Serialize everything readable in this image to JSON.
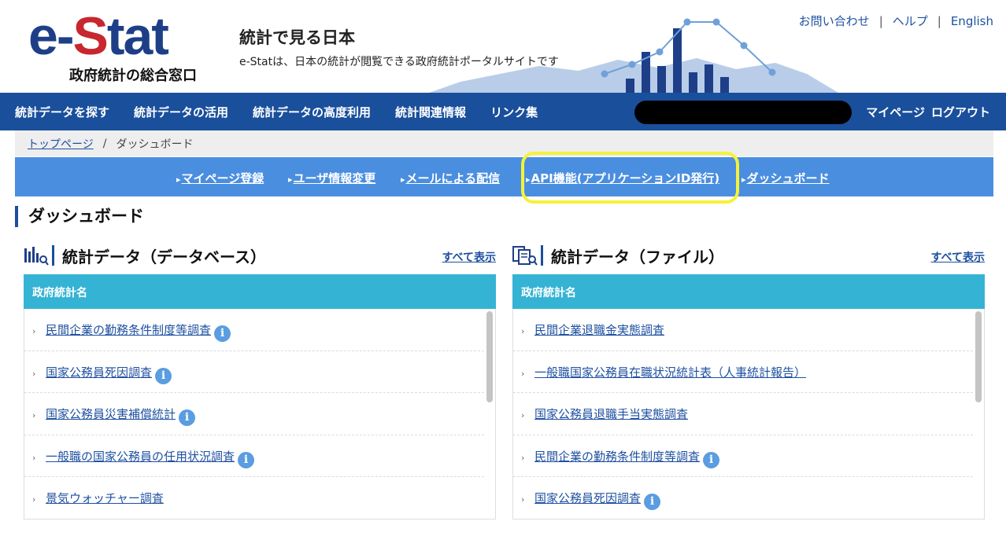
{
  "header": {
    "logo": "e-Stat",
    "logo_sub": "政府統計の総合窓口",
    "title": "統計で見る日本",
    "description": "e-Statは、日本の統計が閲覧できる政府統計ポータルサイトです",
    "links": [
      "お問い合わせ",
      "ヘルプ",
      "English"
    ]
  },
  "mainnav": {
    "items": [
      "統計データを探す",
      "統計データの活用",
      "統計データの高度利用",
      "統計関連情報",
      "リンク集"
    ],
    "mypage": "マイページ",
    "logout": "ログアウト"
  },
  "breadcrumb": {
    "home": "トップページ",
    "sep": "/",
    "current": "ダッシュボード"
  },
  "subnav": {
    "items": [
      "マイページ登録",
      "ユーザ情報変更",
      "メールによる配信",
      "API機能(アプリケーションID発行)",
      "ダッシュボード"
    ]
  },
  "page_title": "ダッシュボード",
  "panels": [
    {
      "title": "統計データ（データベース）",
      "show_all": "すべて表示",
      "column": "政府統計名",
      "rows": [
        "民間企業の勤務条件制度等調査",
        "国家公務員死因調査",
        "国家公務員災害補償統計",
        "一般職の国家公務員の任用状況調査",
        "景気ウォッチャー調査"
      ],
      "info": [
        true,
        true,
        true,
        true,
        false
      ]
    },
    {
      "title": "統計データ（ファイル）",
      "show_all": "すべて表示",
      "column": "政府統計名",
      "rows": [
        "民間企業退職金実態調査",
        "一般職国家公務員在職状況統計表（人事統計報告）",
        "国家公務員退職手当実態調査",
        "民間企業の勤務条件制度等調査",
        "国家公務員死因調査"
      ],
      "info": [
        false,
        false,
        false,
        true,
        true
      ]
    }
  ],
  "info_glyph": "i",
  "colors": {
    "nav": "#1a4f9c",
    "subnav": "#4a8ee0",
    "table_head": "#35b3d4",
    "highlight": "#f5f23a",
    "logo_red": "#c8272f"
  }
}
